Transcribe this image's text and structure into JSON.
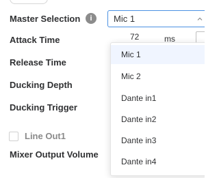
{
  "form": {
    "master_selection_label": "Master Selection",
    "attack_time_label": "Attack Time",
    "release_time_label": "Release Time",
    "ducking_depth_label": "Ducking Depth",
    "ducking_trigger_label": "Ducking Trigger",
    "line_out_label": "Line Out1",
    "mixer_output_volume_label": "Mixer Output Volume",
    "info_icon_glyph": "i"
  },
  "master_select": {
    "selected": "Mic 1",
    "options": [
      "Mic 1",
      "Mic 2",
      "Dante in1",
      "Dante in2",
      "Dante in3",
      "Dante in4"
    ]
  },
  "attack_time": {
    "value": "72",
    "unit": "ms"
  },
  "colors": {
    "accent": "#4a90e2",
    "selected_option_bg": "#f0f5ff",
    "text": "#303133",
    "muted_text": "#8a8a8a"
  },
  "icons": {
    "info": "info-icon",
    "select_chevron": "chevron-up-icon"
  }
}
